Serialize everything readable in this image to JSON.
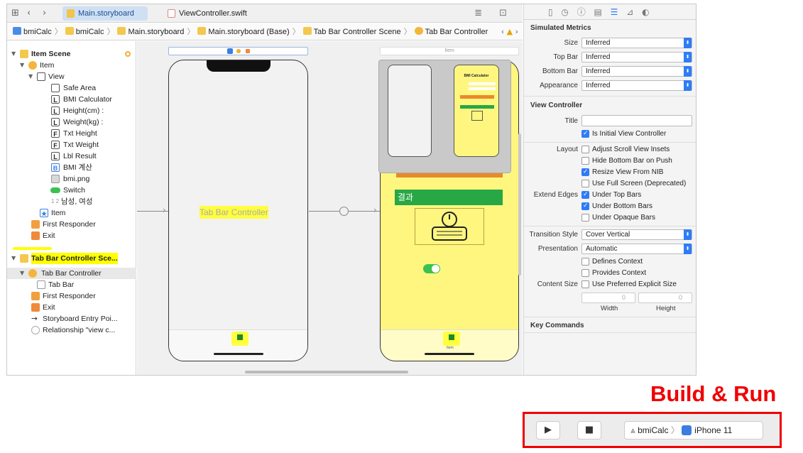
{
  "tabs": [
    {
      "label": "Main.storyboard",
      "active": true
    },
    {
      "label": "ViewController.swift",
      "active": false
    }
  ],
  "breadcrumb": [
    "bmiCalc",
    "bmiCalc",
    "Main.storyboard",
    "Main.storyboard (Base)",
    "Tab Bar Controller Scene",
    "Tab Bar Controller"
  ],
  "outline": {
    "item_scene": "Item Scene",
    "item": "Item",
    "view": "View",
    "safe_area": "Safe Area",
    "bmi_calc": "BMI Calculator",
    "height": "Height(cm) :",
    "weight": "Weight(kg) :",
    "txt_height": "Txt Height",
    "txt_weight": "Txt Weight",
    "lbl_result": "Lbl Result",
    "bmi_btn": "BMI 계산",
    "bmi_png": "bmi.png",
    "switch": "Switch",
    "gender": "남성, 여성",
    "item2": "Item",
    "first_responder": "First Responder",
    "exit": "Exit",
    "tbc_scene": "Tab Bar Controller Sce...",
    "tbc": "Tab Bar Controller",
    "tab_bar": "Tab Bar",
    "first_responder2": "First Responder",
    "exit2": "Exit",
    "entry": "Storyboard Entry Poi...",
    "relationship": "Relationship \"view c..."
  },
  "canvas": {
    "tbc_label": "Tab Bar Controller",
    "item_scene_title": "Item",
    "result_label": "결과",
    "tab_item_label": "Item",
    "preview_title": "BMI Calculator"
  },
  "inspector": {
    "simulated_metrics": "Simulated Metrics",
    "size_label": "Size",
    "size_value": "Inferred",
    "topbar_label": "Top Bar",
    "topbar_value": "Inferred",
    "bottombar_label": "Bottom Bar",
    "bottombar_value": "Inferred",
    "appearance_label": "Appearance",
    "appearance_value": "Inferred",
    "view_controller": "View Controller",
    "title_label": "Title",
    "initial_vc": "Is Initial View Controller",
    "layout_label": "Layout",
    "adjust_scroll": "Adjust Scroll View Insets",
    "hide_bottom": "Hide Bottom Bar on Push",
    "resize_nib": "Resize View From NIB",
    "full_screen": "Use Full Screen (Deprecated)",
    "extend_label": "Extend Edges",
    "under_top": "Under Top Bars",
    "under_bottom": "Under Bottom Bars",
    "under_opaque": "Under Opaque Bars",
    "transition_label": "Transition Style",
    "transition_value": "Cover Vertical",
    "presentation_label": "Presentation",
    "presentation_value": "Automatic",
    "defines_context": "Defines Context",
    "provides_context": "Provides Context",
    "content_size_label": "Content Size",
    "preferred_size": "Use Preferred Explicit Size",
    "width_value": "0",
    "height_value": "0",
    "width_label": "Width",
    "height_label": "Height",
    "key_commands": "Key Commands"
  },
  "build": {
    "title": "Build & Run",
    "scheme": "bmiCalc",
    "device": "iPhone 11"
  }
}
